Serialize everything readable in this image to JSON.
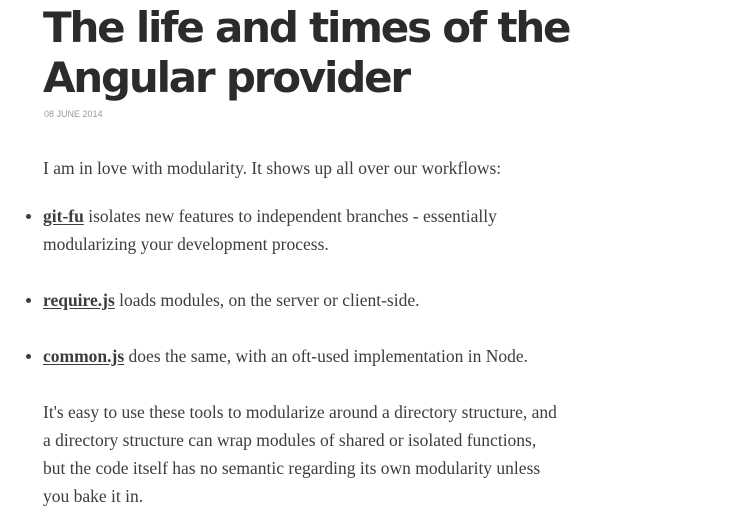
{
  "post": {
    "title_line1": "The life and times of the",
    "title_line2": "Angular provider",
    "date": "08 JUNE 2014",
    "intro": "I am in love with modularity. It shows up all over our workflows:",
    "tools": [
      {
        "link": "git-fu",
        "line1": " isolates new features to independent branches - essentially",
        "line2": "modularizing your development process."
      },
      {
        "link": "require.js",
        "line1": " loads modules, on the server or client-side."
      },
      {
        "link": "common.js",
        "line1": " does the same, with an oft-used implementation in Node."
      }
    ],
    "closing_lines": [
      "It's easy to use these tools to modularize around a directory structure, and",
      "a directory structure can wrap modules of shared or isolated functions,",
      "but the code itself has no semantic regarding its own modularity unless",
      "you bake it in."
    ]
  }
}
